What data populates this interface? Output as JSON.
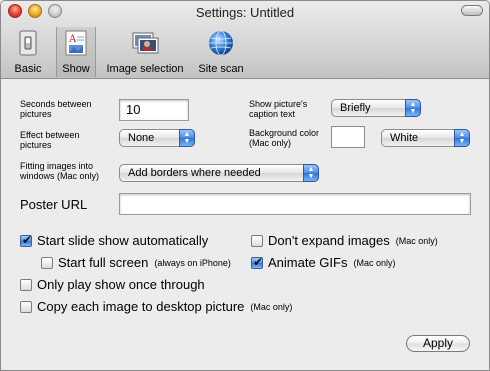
{
  "window": {
    "title": "Settings: Untitled"
  },
  "toolbar": {
    "items": [
      {
        "label": "Basic",
        "icon": "switch-icon"
      },
      {
        "label": "Show",
        "icon": "slideshow-document-icon"
      },
      {
        "label": "Image selection",
        "icon": "photos-icon"
      },
      {
        "label": "Site scan",
        "icon": "globe-icon"
      }
    ],
    "selected": "Show"
  },
  "settings": {
    "seconds_label": "Seconds between pictures",
    "seconds_value": "10",
    "caption_label": "Show picture's caption text",
    "caption_value": "Briefly",
    "effect_label": "Effect between pictures",
    "effect_value": "None",
    "background_label": "Background color (Mac only)",
    "background_value": "White",
    "background_color": "#ffffff",
    "fitting_label": "Fitting images into windows (Mac only)",
    "fitting_value": "Add borders where needed",
    "poster_label": "Poster URL",
    "poster_value": ""
  },
  "options": {
    "start_auto": {
      "label": "Start slide show automatically",
      "checked": true
    },
    "full_screen": {
      "label": "Start full screen",
      "note": "(always on iPhone)",
      "checked": false
    },
    "dont_expand": {
      "label": "Don't expand images",
      "note": "(Mac only)",
      "checked": false
    },
    "animate_gifs": {
      "label": "Animate GIFs",
      "note": "(Mac only)",
      "checked": true
    },
    "play_once": {
      "label": "Only play show once through",
      "checked": false
    },
    "copy_desktop": {
      "label": "Copy each image to desktop picture",
      "note": "(Mac only)",
      "checked": false
    }
  },
  "footer": {
    "apply_label": "Apply"
  },
  "colors": {
    "accent": "#3b82e6",
    "background": "#ececec"
  }
}
